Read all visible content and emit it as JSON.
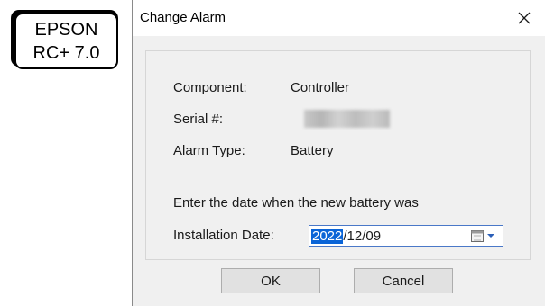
{
  "badge": {
    "line1": "EPSON",
    "line2": "RC+ 7.0"
  },
  "dialog": {
    "title": "Change Alarm",
    "close_icon": "close-icon",
    "fields": {
      "component_label": "Component:",
      "component_value": "Controller",
      "serial_label": "Serial #:",
      "alarm_type_label": "Alarm Type:",
      "alarm_type_value": "Battery"
    },
    "instruction": "Enter the date when the new battery was",
    "installation_date": {
      "label": "Installation Date:",
      "year": "2022",
      "rest": "/12/09",
      "calendar_icon": "calendar-icon",
      "dropdown_icon": "chevron-down-icon"
    },
    "buttons": {
      "ok": "OK",
      "cancel": "Cancel"
    }
  }
}
